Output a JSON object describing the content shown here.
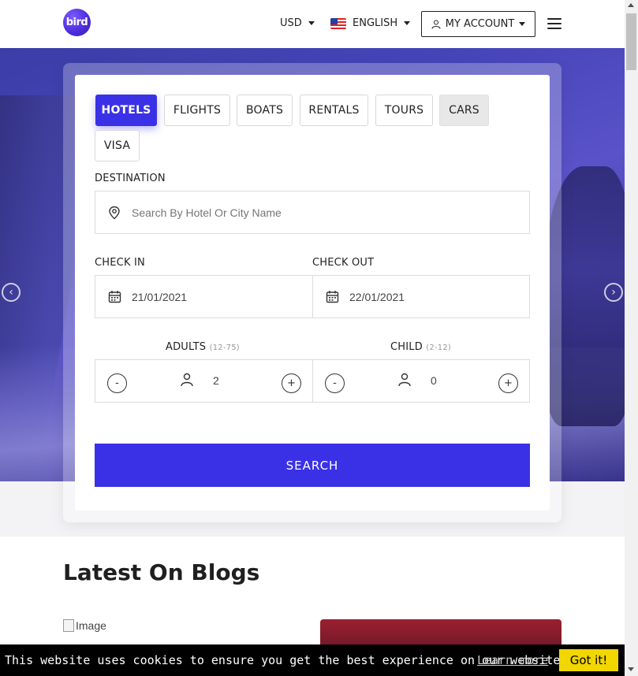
{
  "header": {
    "logo_text": "bird",
    "currency": "USD",
    "language": "ENGLISH",
    "account_label": "MY ACCOUNT"
  },
  "search": {
    "tabs": [
      {
        "label": "HOTELS",
        "state": "active"
      },
      {
        "label": "FLIGHTS",
        "state": "default"
      },
      {
        "label": "BOATS",
        "state": "default"
      },
      {
        "label": "RENTALS",
        "state": "default"
      },
      {
        "label": "TOURS",
        "state": "default"
      },
      {
        "label": "CARS",
        "state": "hover"
      },
      {
        "label": "VISA",
        "state": "default"
      }
    ],
    "destination_label": "DESTINATION",
    "destination_placeholder": "Search By Hotel Or City Name",
    "checkin_label": "CHECK IN",
    "checkin_value": "21/01/2021",
    "checkout_label": "CHECK OUT",
    "checkout_value": "22/01/2021",
    "adults_label": "ADULTS",
    "adults_range": "(12-75)",
    "adults_value": "2",
    "child_label": "CHILD",
    "child_range": "(2-12)",
    "child_value": "0",
    "minus": "-",
    "plus": "+",
    "search_button": "SEARCH"
  },
  "blogs": {
    "title": "Latest On Blogs",
    "image_alt": "Image"
  },
  "cookie": {
    "text": "This website uses cookies to ensure you get the best experience on our website.",
    "link": "Learn more",
    "button": "Got it!"
  },
  "colors": {
    "accent": "#3a31e6",
    "cookie_button": "#f1d600"
  }
}
